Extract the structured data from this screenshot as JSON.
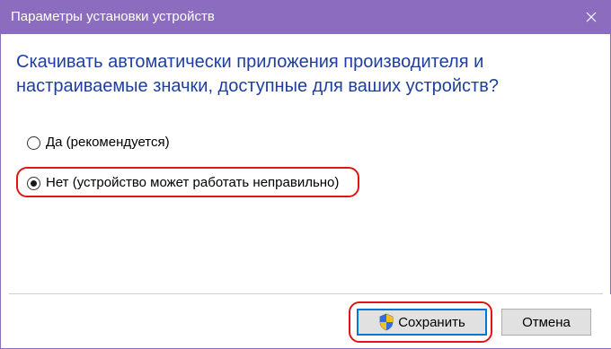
{
  "window": {
    "title": "Параметры установки устройств",
    "titlebar_color": "#8b6cbf"
  },
  "question": "Скачивать автоматически приложения производителя и настраиваемые значки, доступные для ваших устройств?",
  "options": [
    {
      "label": "Да (рекомендуется)",
      "selected": false
    },
    {
      "label": "Нет (устройство может работать неправильно)",
      "selected": true
    }
  ],
  "buttons": {
    "save_label": "Сохранить",
    "save_icon": "uac-shield-icon",
    "cancel_label": "Отмена"
  },
  "annotation_color": "#e01515"
}
